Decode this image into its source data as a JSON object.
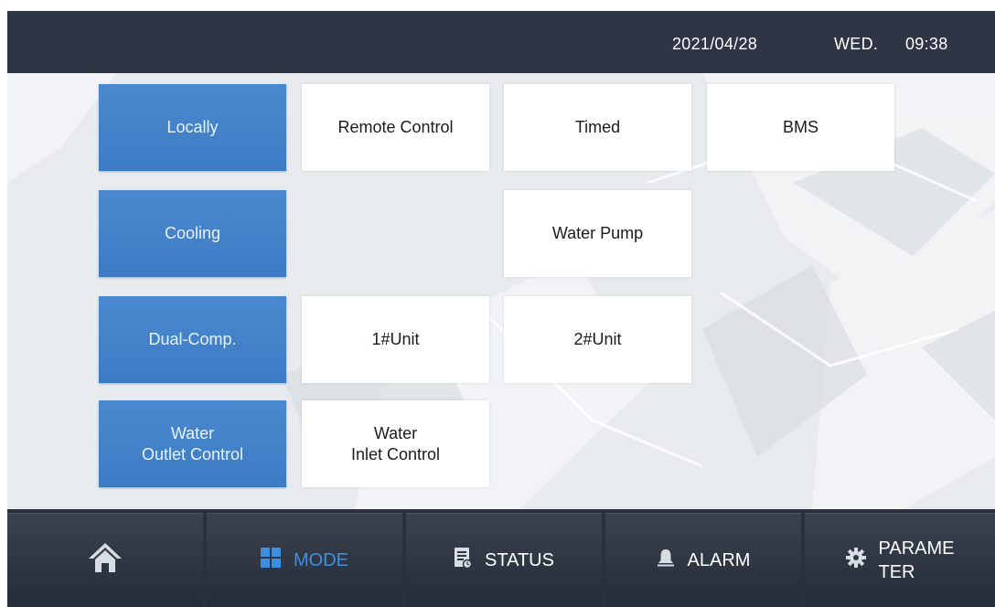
{
  "header": {
    "date": "2021/04/28",
    "weekday": "WED.",
    "time": "09:38"
  },
  "mode_rows": [
    {
      "category": "Locally",
      "options": [
        "Remote Control",
        "Timed",
        "BMS"
      ]
    },
    {
      "category": "Cooling",
      "options": [
        "Water Pump"
      ]
    },
    {
      "category": "Dual-Comp.",
      "options": [
        "1#Unit",
        "2#Unit"
      ]
    },
    {
      "category": "Water\nOutlet Control",
      "options": [
        "Water\nInlet Control"
      ]
    }
  ],
  "nav": {
    "home_icon": "home-icon",
    "mode_label": "MODE",
    "mode_icon": "grid-icon",
    "status_label": "STATUS",
    "status_icon": "clipboard-icon",
    "alarm_label": "ALARM",
    "alarm_icon": "bell-icon",
    "parameter_label": "PARAME\nTER",
    "parameter_icon": "gear-icon",
    "active_tab": "MODE"
  },
  "colors": {
    "header_bg": "#2e3645",
    "selected_button": "#4385ca",
    "option_button": "#ffffff",
    "active_tab_text": "#3d8fe0",
    "content_bg": "#e7ebee"
  }
}
